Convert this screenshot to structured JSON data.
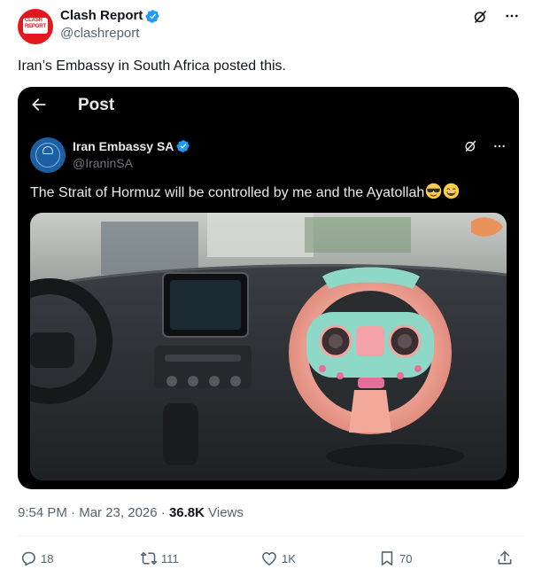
{
  "author": {
    "display_name": "Clash Report",
    "handle": "@clashreport",
    "avatar_text_line1": "CLASH",
    "avatar_text_line2": "REPORT"
  },
  "tweet": {
    "text": "Iran’s Embassy in South Africa posted this."
  },
  "embed": {
    "bar_title": "Post",
    "author": {
      "display_name": "Iran Embassy SA",
      "handle": "@IraninSA"
    },
    "text": "The Strait of Hormuz will be controlled by me and the Ayatollah",
    "emojis": [
      "smiling-face-with-sunglasses",
      "grinning-face-with-smiling-eyes"
    ]
  },
  "meta": {
    "time": "9:54 PM",
    "separator": " · ",
    "date": "Mar 23, 2026",
    "separator2": " · ",
    "views_count": "36.8K",
    "views_label": " Views"
  },
  "actions": {
    "replies": "18",
    "reposts": "111",
    "likes": "1K",
    "bookmarks": "70"
  },
  "colors": {
    "verified": "#1d9bf0",
    "brand_red": "#e3171e",
    "secondary_text": "#536471"
  },
  "icons": [
    "verified-badge-icon",
    "grok-icon",
    "more-icon",
    "back-arrow-icon",
    "reply-icon",
    "repost-icon",
    "like-icon",
    "bookmark-icon",
    "share-icon"
  ]
}
